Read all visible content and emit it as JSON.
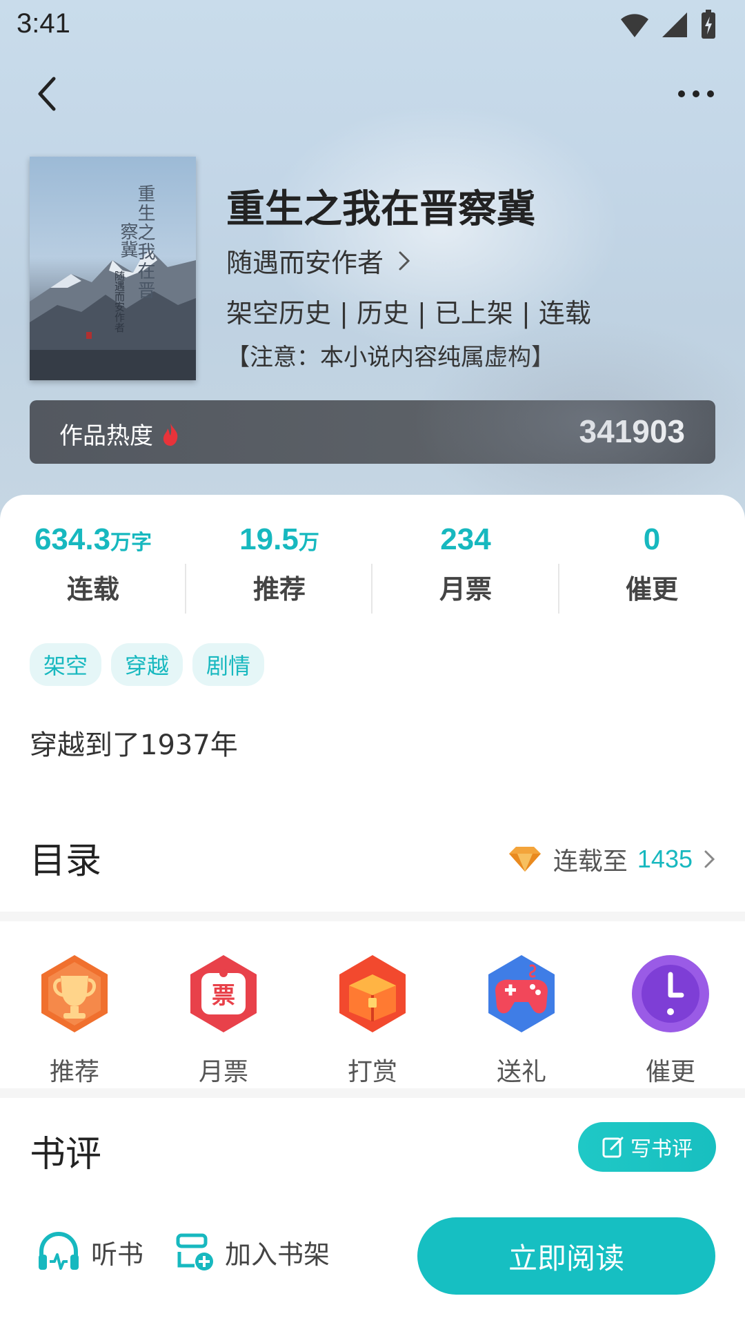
{
  "status_bar": {
    "time": "3:41"
  },
  "book": {
    "cover_title": "重生之我在晋察冀",
    "cover_title_line1": "重生之我在晋",
    "cover_title_line2": "察冀",
    "cover_author": "随遇而安作者",
    "title": "重生之我在晋察冀",
    "author": "随遇而安作者",
    "meta": "架空历史 | 历史 | 已上架 | 连载",
    "note": "【注意：本小说内容纯属虚构】"
  },
  "heat": {
    "label": "作品热度",
    "value": "341903"
  },
  "stats": [
    {
      "value": "634.3",
      "unit": "万字",
      "label": "连载"
    },
    {
      "value": "19.5",
      "unit": "万",
      "label": "推荐"
    },
    {
      "value": "234",
      "unit": "",
      "label": "月票"
    },
    {
      "value": "0",
      "unit": "",
      "label": "催更"
    }
  ],
  "tags": [
    "架空",
    "穿越",
    "剧情"
  ],
  "synopsis": "穿越到了1937年",
  "toc": {
    "title": "目录",
    "prefix": "连载至",
    "count": "1435"
  },
  "actions": [
    {
      "label": "推荐",
      "icon": "trophy-icon"
    },
    {
      "label": "月票",
      "icon": "ticket-icon"
    },
    {
      "label": "打赏",
      "icon": "treasure-chest-icon"
    },
    {
      "label": "送礼",
      "icon": "gamepad-icon"
    },
    {
      "label": "催更",
      "icon": "clock-icon"
    }
  ],
  "review": {
    "title": "书评",
    "write_label": "写书评"
  },
  "bottom_bar": {
    "listen_label": "听书",
    "shelf_label": "加入书架",
    "read_label": "立即阅读"
  },
  "colors": {
    "accent": "#17b8bf",
    "heat_bar": "#585d64"
  }
}
